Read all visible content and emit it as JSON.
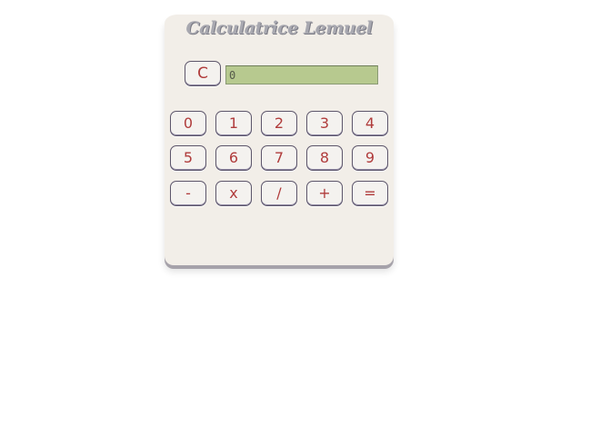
{
  "app": {
    "title": "Calculatrice Lemuel"
  },
  "display": {
    "value": "0"
  },
  "keys": {
    "clear": "C",
    "digits_row1": [
      "0",
      "1",
      "2",
      "3",
      "4"
    ],
    "digits_row2": [
      "5",
      "6",
      "7",
      "8",
      "9"
    ],
    "operators": [
      "-",
      "x",
      "/",
      "+",
      "="
    ]
  },
  "colors": {
    "panel": "#f2eee8",
    "display_bg": "#b7c98f",
    "key_text": "#b03c3c",
    "key_border": "#5d566b",
    "title": "#a8a8b0"
  }
}
